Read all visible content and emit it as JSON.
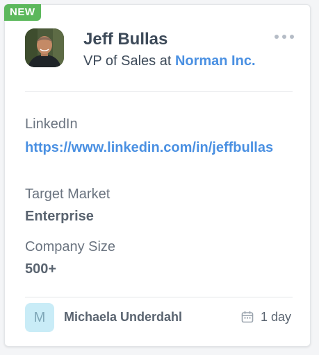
{
  "badge": "NEW",
  "contact": {
    "name": "Jeff Bullas",
    "title_prefix": "VP of Sales at ",
    "company": "Norman Inc."
  },
  "fields": {
    "linkedin_label": "LinkedIn",
    "linkedin_value": "https://www.linkedin.com/in/jeffbullas",
    "market_label": "Target Market",
    "market_value": "Enterprise",
    "size_label": "Company Size",
    "size_value": "500+"
  },
  "owner": {
    "initial": "M",
    "name": "Michaela Underdahl"
  },
  "age": "1 day",
  "icons": {
    "more": "more-horizontal-icon",
    "calendar": "calendar-icon"
  },
  "colors": {
    "badge": "#5cb85c",
    "accent": "#4a90e2",
    "text": "#3d4a59",
    "owner_avatar": "#c9ecf7"
  }
}
